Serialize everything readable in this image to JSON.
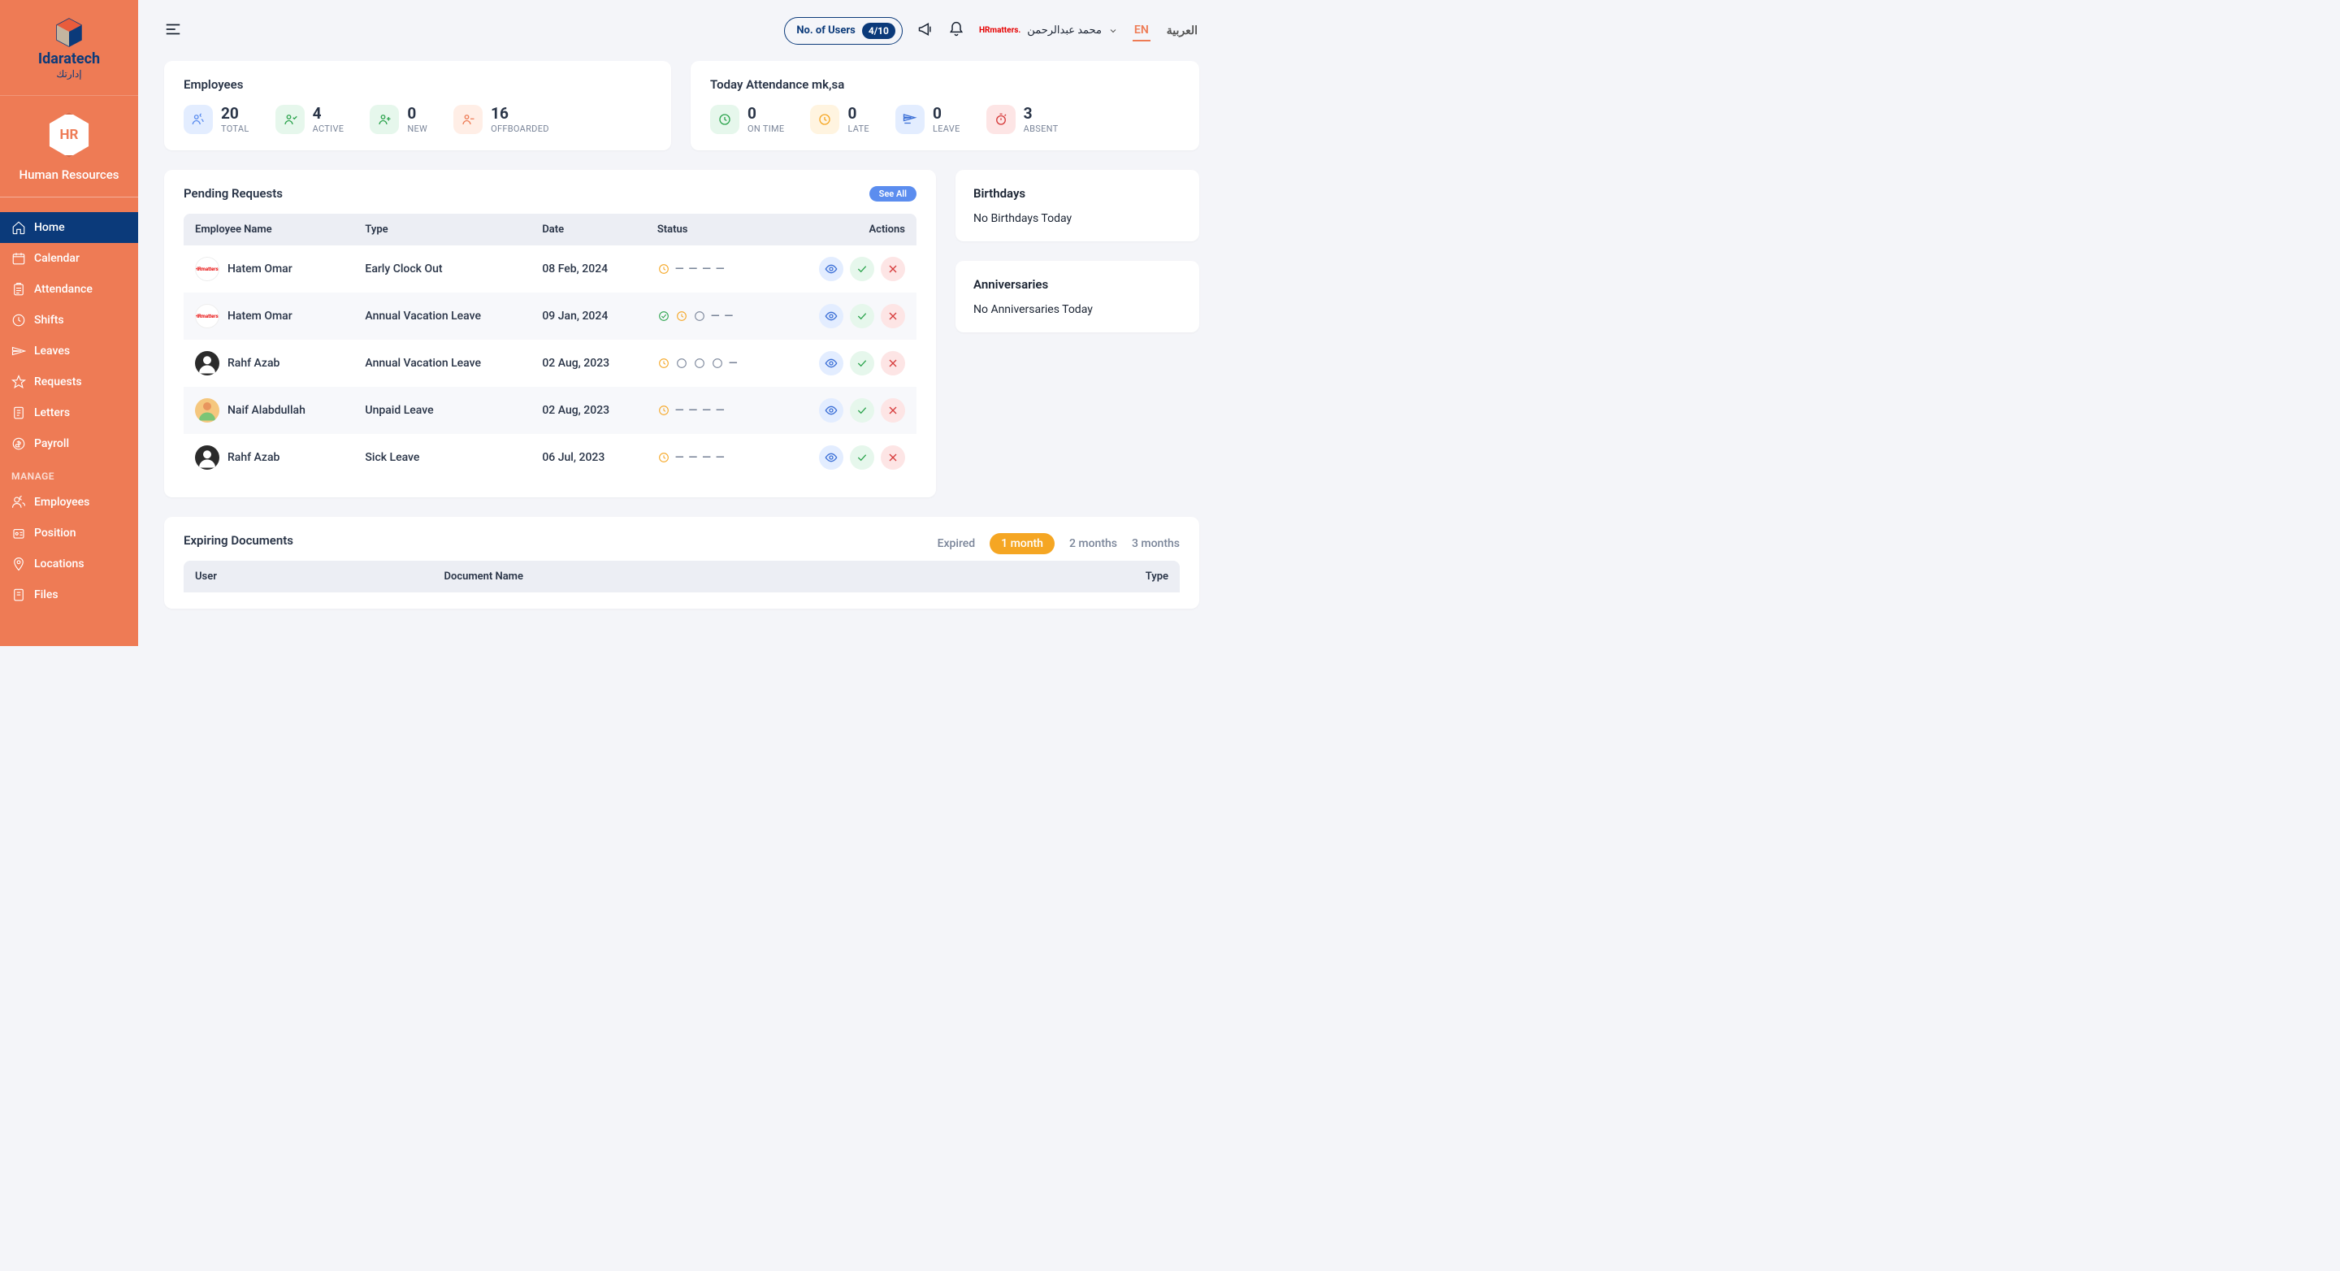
{
  "brand": {
    "name": "Idaratech",
    "sub": "إدارتك"
  },
  "hr": {
    "badge": "HR",
    "title": "Human Resources"
  },
  "nav": {
    "home": "Home",
    "calendar": "Calendar",
    "attendance": "Attendance",
    "shifts": "Shifts",
    "leaves": "Leaves",
    "requests": "Requests",
    "letters": "Letters",
    "payroll": "Payroll",
    "manage": "MANAGE",
    "employees": "Employees",
    "position": "Position",
    "locations": "Locations",
    "files": "Files"
  },
  "topbar": {
    "users_label": "No. of Users",
    "users_count": "4/10",
    "user_name": "محمد عبدالرحمن",
    "lang_en": "EN",
    "lang_ar": "العربية"
  },
  "employees_card": {
    "title": "Employees",
    "total": {
      "n": "20",
      "l": "TOTAL"
    },
    "active": {
      "n": "4",
      "l": "ACTIVE"
    },
    "new": {
      "n": "0",
      "l": "NEW"
    },
    "offboarded": {
      "n": "16",
      "l": "OFFBOARDED"
    }
  },
  "attendance_card": {
    "title": "Today Attendance mk,sa",
    "ontime": {
      "n": "0",
      "l": "ON TIME"
    },
    "late": {
      "n": "0",
      "l": "LATE"
    },
    "leave": {
      "n": "0",
      "l": "LEAVE"
    },
    "absent": {
      "n": "3",
      "l": "ABSENT"
    }
  },
  "pending": {
    "title": "Pending Requests",
    "see_all": "See All",
    "cols": {
      "name": "Employee Name",
      "type": "Type",
      "date": "Date",
      "status": "Status",
      "actions": "Actions"
    },
    "rows": [
      {
        "name": "Hatem Omar",
        "avatar": "hrm",
        "type": "Early Clock Out",
        "date": "08 Feb, 2024",
        "status": "p----"
      },
      {
        "name": "Hatem Omar",
        "avatar": "hrm",
        "type": "Annual Vacation Leave",
        "date": "09 Jan, 2024",
        "status": "apo--"
      },
      {
        "name": "Rahf Azab",
        "avatar": "person",
        "type": "Annual Vacation Leave",
        "date": "02 Aug, 2023",
        "status": "pooo-"
      },
      {
        "name": "Naif Alabdullah",
        "avatar": "person2",
        "type": "Unpaid Leave",
        "date": "02 Aug, 2023",
        "status": "p----"
      },
      {
        "name": "Rahf Azab",
        "avatar": "person",
        "type": "Sick Leave",
        "date": "06 Jul, 2023",
        "status": "p----"
      }
    ]
  },
  "birthdays": {
    "title": "Birthdays",
    "empty": "No Birthdays Today"
  },
  "anniversaries": {
    "title": "Anniversaries",
    "empty": "No Anniversaries Today"
  },
  "expiring": {
    "title": "Expiring Documents",
    "tabs": {
      "expired": "Expired",
      "m1": "1 month",
      "m2": "2 months",
      "m3": "3 months"
    },
    "cols": {
      "user": "User",
      "doc": "Document Name",
      "type": "Type"
    }
  }
}
